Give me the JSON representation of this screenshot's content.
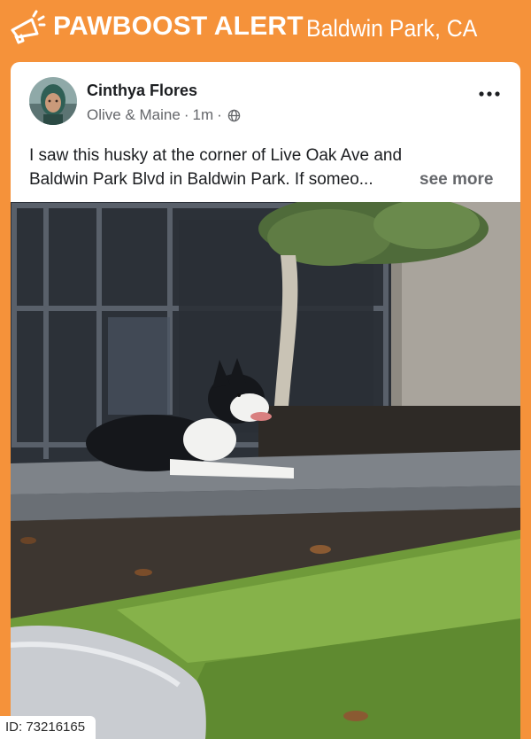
{
  "header": {
    "brand": "PAWBOOST ALERT",
    "location": "Baldwin Park, CA",
    "icon": "megaphone-icon",
    "background_color": "#f5923a"
  },
  "post": {
    "author": "Cinthya Flores",
    "group": "Olive & Maine",
    "time": "1m",
    "separator": "·",
    "privacy_icon": "globe-icon",
    "more_icon": "more-options-icon",
    "text_line_1": "I saw this husky at the corner of Live Oak Ave and",
    "text_line_2": "Baldwin Park Blvd in Baldwin Park. If someo...",
    "see_more_label": "see more"
  },
  "footer": {
    "id_label": "ID: 73216165"
  }
}
